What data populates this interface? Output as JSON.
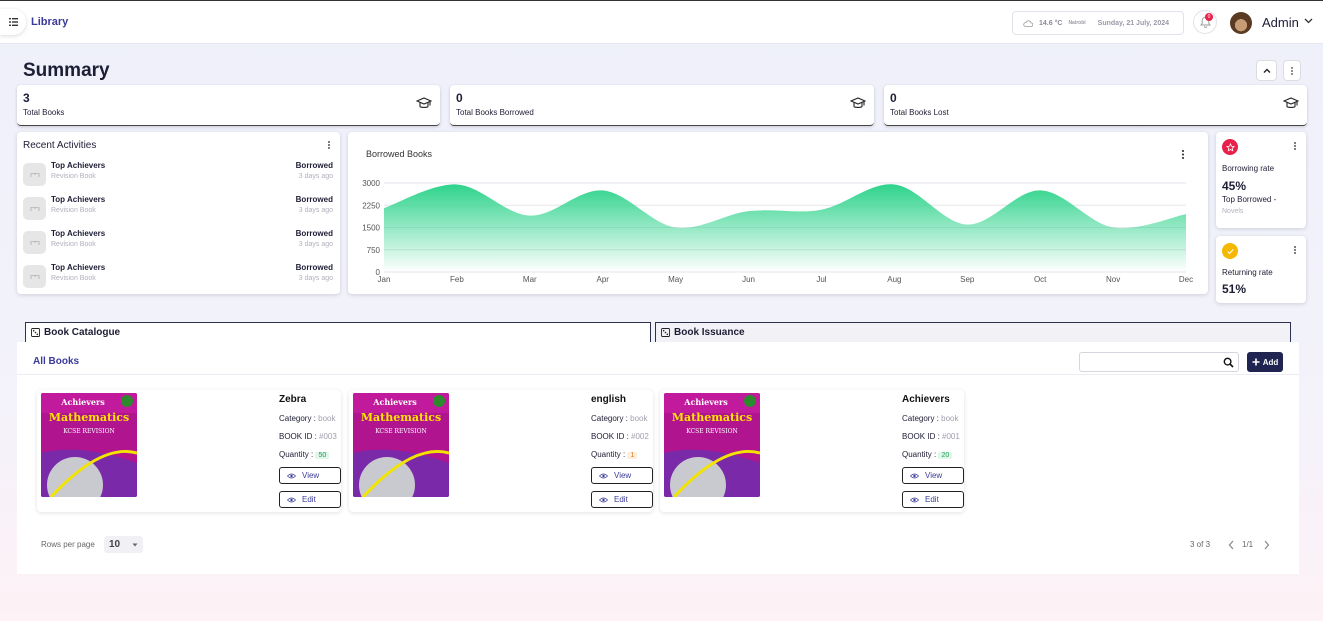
{
  "header": {
    "app_title": "Library",
    "weather": {
      "temp": "14.6 °C",
      "city": "Nairobi",
      "date": "Sunday, 21 July, 2024"
    },
    "notification_count": "0",
    "user_name": "Admin"
  },
  "summary": {
    "title": "Summary",
    "stats": [
      {
        "value": "3",
        "label": "Total Books"
      },
      {
        "value": "0",
        "label": "Total Books Borrowed"
      },
      {
        "value": "0",
        "label": "Total Books Lost"
      }
    ]
  },
  "recent": {
    "title": "Recent Activities",
    "items": [
      {
        "title": "Top Achievers",
        "subtitle": "Revision Book",
        "status": "Borrowed",
        "time": "3 days ago"
      },
      {
        "title": "Top Achievers",
        "subtitle": "Revision Book",
        "status": "Borrowed",
        "time": "3 days ago"
      },
      {
        "title": "Top Achievers",
        "subtitle": "Revision Book",
        "status": "Borrowed",
        "time": "3 days ago"
      },
      {
        "title": "Top Achievers",
        "subtitle": "Revision Book",
        "status": "Borrowed",
        "time": "3 days ago"
      }
    ]
  },
  "chart_data": {
    "type": "area",
    "title": "Borrowed Books",
    "categories": [
      "Jan",
      "Feb",
      "Mar",
      "Apr",
      "May",
      "Jun",
      "Jul",
      "Aug",
      "Sep",
      "Oct",
      "Nov",
      "Dec"
    ],
    "values": [
      2150,
      2950,
      1900,
      2750,
      1500,
      2050,
      2100,
      2950,
      1600,
      2750,
      1500,
      1950
    ],
    "yticks": [
      0,
      750,
      1500,
      2250,
      3000
    ],
    "ylim": [
      0,
      3000
    ],
    "grid": true,
    "color": "#2ed38b"
  },
  "rates": {
    "borrowing": {
      "label": "Borrowing rate",
      "value": "45%",
      "top_label": "Top Borrowed -",
      "top_value": "Novels",
      "color": "#e8204a"
    },
    "returning": {
      "label": "Returning rate",
      "value": "51%",
      "color": "#f5b800"
    }
  },
  "tabs": [
    {
      "label": "Book Catalogue"
    },
    {
      "label": "Book Issuance"
    }
  ],
  "catalogue": {
    "section_title": "All Books",
    "add_label": "Add",
    "labels": {
      "category": "Category :",
      "book_id": "BOOK ID :",
      "quantity": "Quantity :",
      "view": "View",
      "edit": "Edit"
    },
    "cover": {
      "line1": "Achievers",
      "line2": "Mathematics",
      "line3": "KCSE REVISION"
    },
    "books": [
      {
        "title": "Zebra",
        "category": "book",
        "id": "#003",
        "quantity": "50",
        "qty_bg": "#dff6e8",
        "qty_fg": "#1f9d55"
      },
      {
        "title": "english",
        "category": "book",
        "id": "#002",
        "quantity": "1",
        "qty_bg": "#fdeede",
        "qty_fg": "#e07a10"
      },
      {
        "title": "Achievers",
        "category": "book",
        "id": "#001",
        "quantity": "20",
        "qty_bg": "#dff6e8",
        "qty_fg": "#1f9d55"
      }
    ],
    "pagination": {
      "rows_label": "Rows per page",
      "rows_value": "10",
      "range": "3 of 3",
      "page": "1/1"
    }
  }
}
